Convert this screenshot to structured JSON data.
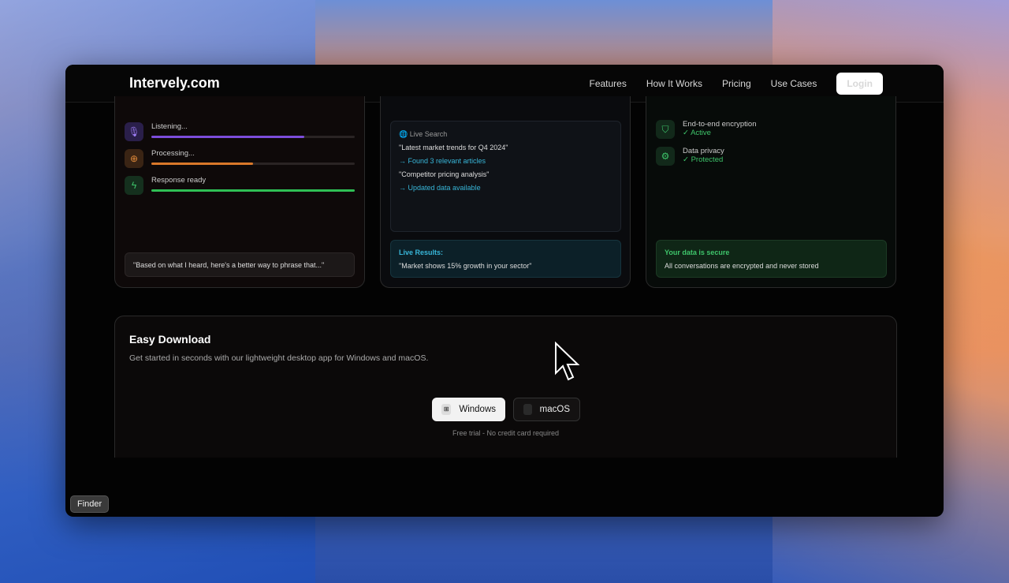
{
  "nav": {
    "logo": "Intervely.com",
    "links": [
      "Features",
      "How It Works",
      "Pricing",
      "Use Cases"
    ],
    "login": "Login"
  },
  "card1": {
    "steps": [
      {
        "label": "Listening...",
        "progress": 0.75,
        "color": "#7c4ddb"
      },
      {
        "label": "Processing...",
        "progress": 0.5,
        "color": "#d9782a"
      },
      {
        "label": "Response ready",
        "progress": 1.0,
        "color": "#2fbf55"
      }
    ],
    "quote": "\"Based on what I heard, here's a better way to phrase that...\""
  },
  "card2": {
    "title": "Live Search",
    "q1": "\"Latest market trends for Q4 2024\"",
    "r1": "→ Found 3 relevant articles",
    "q2": "\"Competitor pricing analysis\"",
    "r2": "→ Updated data available",
    "results_title": "Live Results:",
    "results_text": "\"Market shows 15% growth in your sector\""
  },
  "card3": {
    "items": [
      {
        "label": "End-to-end encryption",
        "status": "✓ Active"
      },
      {
        "label": "Data privacy",
        "status": "✓ Protected"
      }
    ],
    "secure_title": "Your data is secure",
    "secure_text": "All conversations are encrypted and never stored"
  },
  "download": {
    "title": "Easy Download",
    "subtitle": "Get started in seconds with our lightweight desktop app for Windows and macOS.",
    "windows": "Windows",
    "macos": "macOS",
    "note": "Free trial - No credit card required"
  },
  "dock": {
    "tooltip": "Finder"
  }
}
